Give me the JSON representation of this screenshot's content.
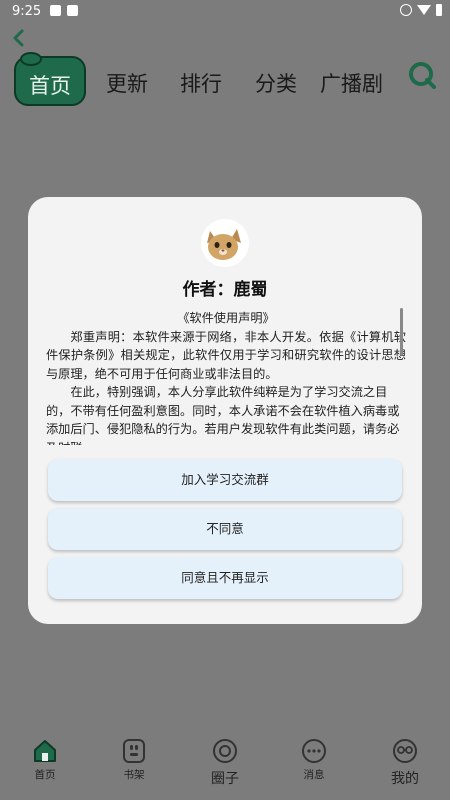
{
  "status_bar": {
    "time": "9:25"
  },
  "top_nav": {
    "tabs": [
      "首页",
      "更新",
      "排行",
      "分类",
      "广播剧"
    ]
  },
  "dialog": {
    "author": "作者：鹿蜀",
    "notice_title": "《软件使用声明》",
    "paragraph1": "郑重声明：本软件来源于网络，非本人开发。依据《计算机软件保护条例》相关规定，此软件仅用于学习和研究软件的设计思想与原理，绝不可用于任何商业或非法目的。",
    "paragraph2": "在此，特别强调，本人分享此软件纯粹是为了学习交流之目的，不带有任何盈利意图。同时，本人承诺不会在软件植入病毒或添加后门、侵犯隐私的行为。若用户发现软件有此类问题，请务必及时联",
    "buttons": [
      "加入学习交流群",
      "不同意",
      "同意且不再显示"
    ]
  },
  "bottom_nav": {
    "items": [
      "首页",
      "书架",
      "圈子",
      "消息",
      "我的"
    ]
  },
  "colors": {
    "accent": "#1f6a4a",
    "button_bg": "#e4f1fb",
    "overlay": "#7c7c7c"
  }
}
